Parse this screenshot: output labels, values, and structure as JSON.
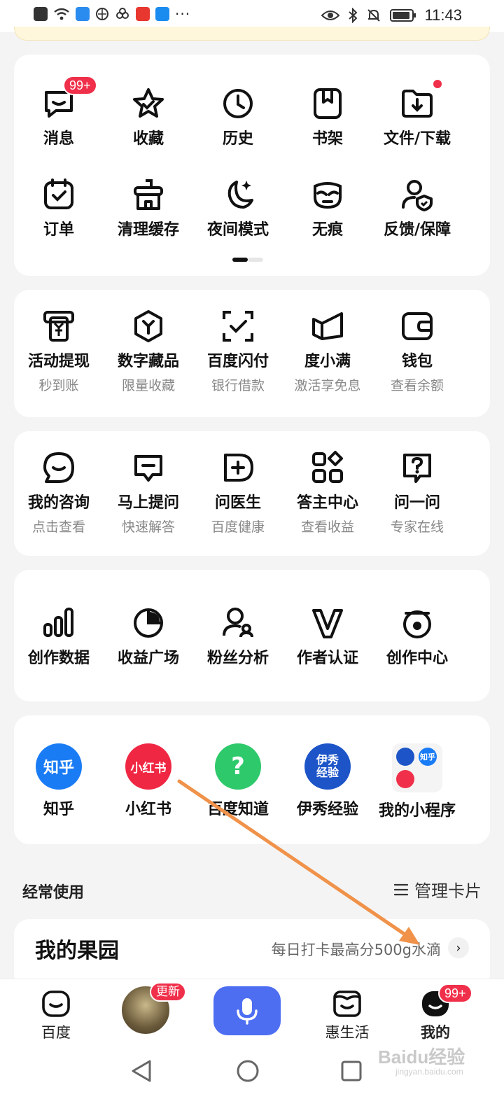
{
  "status_bar": {
    "time": "11:43"
  },
  "card_main": {
    "row1": [
      {
        "label": "消息",
        "badge": "99+"
      },
      {
        "label": "收藏"
      },
      {
        "label": "历史"
      },
      {
        "label": "书架"
      },
      {
        "label": "文件/下载"
      }
    ],
    "row2": [
      {
        "label": "订单"
      },
      {
        "label": "清理缓存"
      },
      {
        "label": "夜间模式"
      },
      {
        "label": "无痕"
      },
      {
        "label": "反馈/保障"
      }
    ]
  },
  "card_finance": [
    {
      "label": "活动提现",
      "sub": "秒到账"
    },
    {
      "label": "数字藏品",
      "sub": "限量收藏"
    },
    {
      "label": "百度闪付",
      "sub": "银行借款"
    },
    {
      "label": "度小满",
      "sub": "激活享免息"
    },
    {
      "label": "钱包",
      "sub": "查看余额"
    }
  ],
  "card_qa": [
    {
      "label": "我的咨询",
      "sub": "点击查看"
    },
    {
      "label": "马上提问",
      "sub": "快速解答"
    },
    {
      "label": "问医生",
      "sub": "百度健康"
    },
    {
      "label": "答主中心",
      "sub": "查看收益"
    },
    {
      "label": "问一问",
      "sub": "专家在线"
    }
  ],
  "card_creator": [
    {
      "label": "创作数据"
    },
    {
      "label": "收益广场"
    },
    {
      "label": "粉丝分析"
    },
    {
      "label": "作者认证"
    },
    {
      "label": "创作中心"
    }
  ],
  "card_apps": [
    {
      "label": "知乎",
      "logo_text": "知乎",
      "color": "#1a7cf5"
    },
    {
      "label": "小红书",
      "logo_text": "小红书",
      "color": "#f02743"
    },
    {
      "label": "百度知道",
      "logo_text": "?",
      "color": "#2dc96b"
    },
    {
      "label": "伊秀经验",
      "logo_text": "伊秀经验",
      "color": "#1d55c8"
    },
    {
      "label": "我的小程序",
      "mini_logo": "知乎"
    }
  ],
  "section": {
    "title": "经常使用",
    "manage_label": "管理卡片"
  },
  "orchard": {
    "title": "我的果园",
    "tip": "每日打卡最高分500g水滴"
  },
  "tabbar": {
    "home": "百度",
    "avatar_badge": "更新",
    "life": "惠生活",
    "mine": "我的",
    "mine_badge": "99+"
  },
  "watermark": {
    "text": "Baidu经验",
    "sub": "jingyan.baidu.com"
  },
  "colors": {
    "accent": "#4e6ef2",
    "badge": "#f0304a",
    "arrow": "#f0924a"
  }
}
